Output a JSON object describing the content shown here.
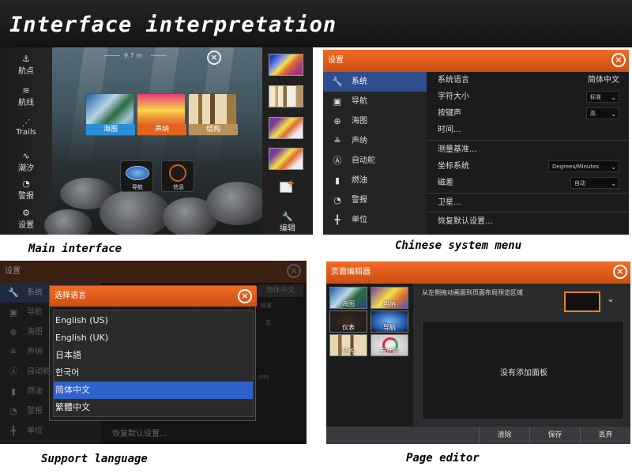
{
  "header": {
    "title": "Interface interpretation"
  },
  "captions": {
    "main_interface": "Main interface",
    "chinese_menu": "Chinese system menu",
    "support_language": "Support language",
    "page_editor": "Page editor"
  },
  "main_interface": {
    "sidebar": [
      {
        "label": "航点",
        "icon": "waypoint-icon"
      },
      {
        "label": "航线",
        "icon": "route-icon"
      },
      {
        "label": "Trails",
        "icon": "trails-icon"
      },
      {
        "label": "潮汐",
        "icon": "tide-icon"
      },
      {
        "label": "警报",
        "icon": "alarm-icon"
      },
      {
        "label": "设置",
        "icon": "gear-icon"
      }
    ],
    "depth_label": "9.7 m",
    "apps": [
      {
        "label": "海图",
        "color": "#2a8fd6"
      },
      {
        "label": "声纳",
        "color": "#e0641d"
      },
      {
        "label": "结构",
        "color": "#b8915a"
      }
    ],
    "mini_apps": [
      {
        "label": "导航",
        "icon": "compass-icon"
      },
      {
        "label": "信息",
        "icon": "gauge-icon"
      }
    ],
    "edit_label": "编辑"
  },
  "system_menu": {
    "title": "设置",
    "nav": [
      {
        "label": "系统",
        "icon": "wrench-icon",
        "selected": true
      },
      {
        "label": "导航",
        "icon": "navigation-icon"
      },
      {
        "label": "海图",
        "icon": "globe-icon"
      },
      {
        "label": "声纳",
        "icon": "sonar-icon"
      },
      {
        "label": "自动舵",
        "icon": "autopilot-icon"
      },
      {
        "label": "燃油",
        "icon": "fuel-icon"
      },
      {
        "label": "警报",
        "icon": "alarm-icon"
      },
      {
        "label": "单位",
        "icon": "units-icon"
      }
    ],
    "rows": [
      {
        "label": "系统语言",
        "value": "简体中文"
      },
      {
        "label": "字符大小",
        "value": "标准"
      },
      {
        "label": "按键声",
        "value": "高"
      },
      {
        "label": "时间..."
      },
      {
        "label": "测量基准..."
      },
      {
        "label": "坐标系统",
        "value": "Degrees/Minutes"
      },
      {
        "label": "磁差",
        "value": "自动"
      },
      {
        "label": "卫星..."
      },
      {
        "label": "恢复默认设置..."
      }
    ]
  },
  "language_dialog": {
    "bg_title": "设置",
    "bg_nav": [
      "系统",
      "导航",
      "海图",
      "声纳",
      "自动舵",
      "燃油",
      "警报",
      "单位"
    ],
    "bg_values": [
      "简体中文",
      "标准",
      "高",
      "utes"
    ],
    "bg_restore": "恢复默认设置...",
    "title": "选择语言",
    "options": [
      "English (US)",
      "English (UK)",
      "日本語",
      "한국어",
      "简体中文",
      "繁體中文"
    ],
    "selected_index": 4
  },
  "page_editor": {
    "title": "页面编辑器",
    "tiles": [
      "海图",
      "声纳",
      "仪表",
      "导航",
      "结构",
      "自动舵"
    ],
    "hint": "从左侧拖动画面到页面布局预览区域",
    "empty_text": "没有添加面板",
    "buttons": {
      "clear": "清除",
      "save": "保存",
      "discard": "丢弃"
    }
  }
}
